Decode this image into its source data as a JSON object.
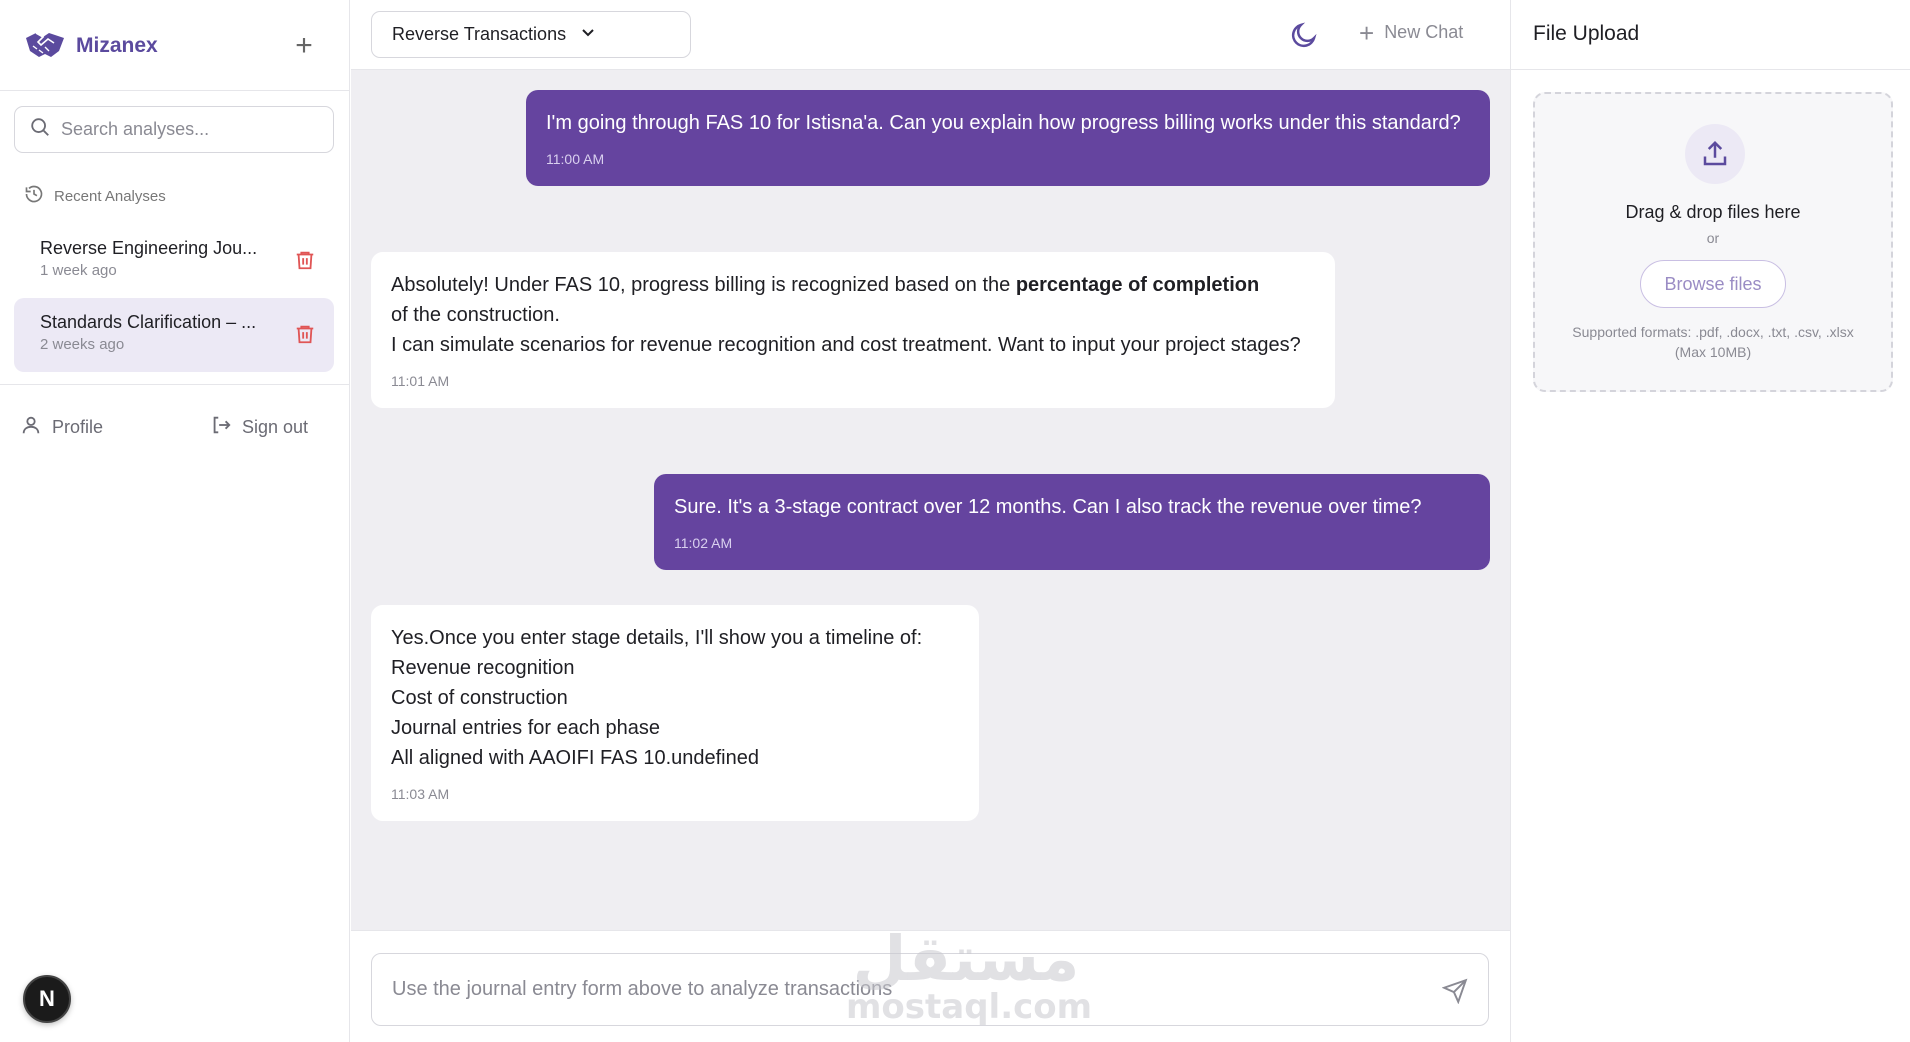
{
  "sidebar": {
    "brand": "Mizanex",
    "search_placeholder": "Search analyses...",
    "recent_label": "Recent Analyses",
    "items": [
      {
        "title": "Reverse Engineering Jou...",
        "time": "1 week ago"
      },
      {
        "title": "Standards Clarification – ...",
        "time": "2 weeks ago"
      }
    ],
    "profile_label": "Profile",
    "signout_label": "Sign out",
    "badge_letter": "N"
  },
  "header": {
    "mode": "Reverse Transactions",
    "new_chat_label": "New Chat"
  },
  "messages": [
    {
      "role": "user",
      "text": "I'm going through FAS 10 for Istisna'a. Can you explain how progress billing works under this standard?",
      "time": "11:00 AM"
    },
    {
      "role": "assistant",
      "line1_pre": "Absolutely! Under FAS 10, progress billing is recognized based on the ",
      "line1_bold": "percentage of completion",
      "line2": "of the construction.",
      "line3": "I can simulate scenarios for revenue recognition and cost treatment. Want to input your project stages?",
      "time": "11:01 AM"
    },
    {
      "role": "user",
      "text": "Sure. It's a 3-stage contract over 12 months. Can I also track the revenue over time?",
      "time": "11:02 AM"
    },
    {
      "role": "assistant",
      "lines": [
        "Yes.Once you enter stage details, I'll show you a timeline of:",
        "Revenue recognition",
        "Cost of construction",
        "Journal entries for each phase",
        "All aligned with AAOIFI FAS 10.undefined"
      ],
      "time": "11:03 AM"
    }
  ],
  "composer": {
    "placeholder": "Use the journal entry form above to analyze transactions"
  },
  "watermark": {
    "arabic": "مستقل",
    "latin": "mostaql.com"
  },
  "upload": {
    "title": "File Upload",
    "drop_text": "Drag & drop files here",
    "or_text": "or",
    "browse_label": "Browse files",
    "formats": "Supported formats: .pdf, .docx, .txt, .csv, .xlsx (Max 10MB)"
  },
  "colors": {
    "accent": "#65449f",
    "brand": "#5b4a9e",
    "delete": "#e05555",
    "chat_bg": "#efeef2"
  }
}
